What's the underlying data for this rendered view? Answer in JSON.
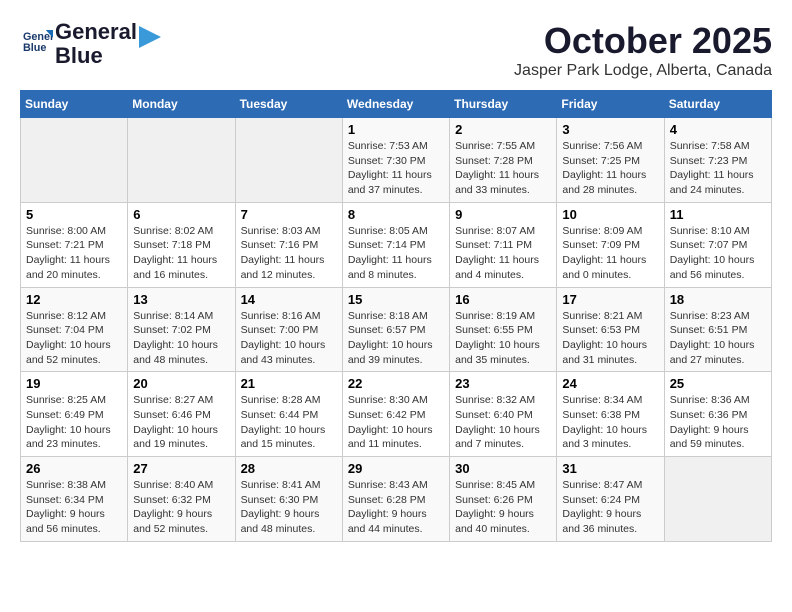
{
  "header": {
    "logo_line1": "General",
    "logo_line2": "Blue",
    "month": "October 2025",
    "location": "Jasper Park Lodge, Alberta, Canada"
  },
  "weekdays": [
    "Sunday",
    "Monday",
    "Tuesday",
    "Wednesday",
    "Thursday",
    "Friday",
    "Saturday"
  ],
  "weeks": [
    [
      {
        "day": "",
        "info": ""
      },
      {
        "day": "",
        "info": ""
      },
      {
        "day": "",
        "info": ""
      },
      {
        "day": "1",
        "info": "Sunrise: 7:53 AM\nSunset: 7:30 PM\nDaylight: 11 hours and 37 minutes."
      },
      {
        "day": "2",
        "info": "Sunrise: 7:55 AM\nSunset: 7:28 PM\nDaylight: 11 hours and 33 minutes."
      },
      {
        "day": "3",
        "info": "Sunrise: 7:56 AM\nSunset: 7:25 PM\nDaylight: 11 hours and 28 minutes."
      },
      {
        "day": "4",
        "info": "Sunrise: 7:58 AM\nSunset: 7:23 PM\nDaylight: 11 hours and 24 minutes."
      }
    ],
    [
      {
        "day": "5",
        "info": "Sunrise: 8:00 AM\nSunset: 7:21 PM\nDaylight: 11 hours and 20 minutes."
      },
      {
        "day": "6",
        "info": "Sunrise: 8:02 AM\nSunset: 7:18 PM\nDaylight: 11 hours and 16 minutes."
      },
      {
        "day": "7",
        "info": "Sunrise: 8:03 AM\nSunset: 7:16 PM\nDaylight: 11 hours and 12 minutes."
      },
      {
        "day": "8",
        "info": "Sunrise: 8:05 AM\nSunset: 7:14 PM\nDaylight: 11 hours and 8 minutes."
      },
      {
        "day": "9",
        "info": "Sunrise: 8:07 AM\nSunset: 7:11 PM\nDaylight: 11 hours and 4 minutes."
      },
      {
        "day": "10",
        "info": "Sunrise: 8:09 AM\nSunset: 7:09 PM\nDaylight: 11 hours and 0 minutes."
      },
      {
        "day": "11",
        "info": "Sunrise: 8:10 AM\nSunset: 7:07 PM\nDaylight: 10 hours and 56 minutes."
      }
    ],
    [
      {
        "day": "12",
        "info": "Sunrise: 8:12 AM\nSunset: 7:04 PM\nDaylight: 10 hours and 52 minutes."
      },
      {
        "day": "13",
        "info": "Sunrise: 8:14 AM\nSunset: 7:02 PM\nDaylight: 10 hours and 48 minutes."
      },
      {
        "day": "14",
        "info": "Sunrise: 8:16 AM\nSunset: 7:00 PM\nDaylight: 10 hours and 43 minutes."
      },
      {
        "day": "15",
        "info": "Sunrise: 8:18 AM\nSunset: 6:57 PM\nDaylight: 10 hours and 39 minutes."
      },
      {
        "day": "16",
        "info": "Sunrise: 8:19 AM\nSunset: 6:55 PM\nDaylight: 10 hours and 35 minutes."
      },
      {
        "day": "17",
        "info": "Sunrise: 8:21 AM\nSunset: 6:53 PM\nDaylight: 10 hours and 31 minutes."
      },
      {
        "day": "18",
        "info": "Sunrise: 8:23 AM\nSunset: 6:51 PM\nDaylight: 10 hours and 27 minutes."
      }
    ],
    [
      {
        "day": "19",
        "info": "Sunrise: 8:25 AM\nSunset: 6:49 PM\nDaylight: 10 hours and 23 minutes."
      },
      {
        "day": "20",
        "info": "Sunrise: 8:27 AM\nSunset: 6:46 PM\nDaylight: 10 hours and 19 minutes."
      },
      {
        "day": "21",
        "info": "Sunrise: 8:28 AM\nSunset: 6:44 PM\nDaylight: 10 hours and 15 minutes."
      },
      {
        "day": "22",
        "info": "Sunrise: 8:30 AM\nSunset: 6:42 PM\nDaylight: 10 hours and 11 minutes."
      },
      {
        "day": "23",
        "info": "Sunrise: 8:32 AM\nSunset: 6:40 PM\nDaylight: 10 hours and 7 minutes."
      },
      {
        "day": "24",
        "info": "Sunrise: 8:34 AM\nSunset: 6:38 PM\nDaylight: 10 hours and 3 minutes."
      },
      {
        "day": "25",
        "info": "Sunrise: 8:36 AM\nSunset: 6:36 PM\nDaylight: 9 hours and 59 minutes."
      }
    ],
    [
      {
        "day": "26",
        "info": "Sunrise: 8:38 AM\nSunset: 6:34 PM\nDaylight: 9 hours and 56 minutes."
      },
      {
        "day": "27",
        "info": "Sunrise: 8:40 AM\nSunset: 6:32 PM\nDaylight: 9 hours and 52 minutes."
      },
      {
        "day": "28",
        "info": "Sunrise: 8:41 AM\nSunset: 6:30 PM\nDaylight: 9 hours and 48 minutes."
      },
      {
        "day": "29",
        "info": "Sunrise: 8:43 AM\nSunset: 6:28 PM\nDaylight: 9 hours and 44 minutes."
      },
      {
        "day": "30",
        "info": "Sunrise: 8:45 AM\nSunset: 6:26 PM\nDaylight: 9 hours and 40 minutes."
      },
      {
        "day": "31",
        "info": "Sunrise: 8:47 AM\nSunset: 6:24 PM\nDaylight: 9 hours and 36 minutes."
      },
      {
        "day": "",
        "info": ""
      }
    ]
  ]
}
